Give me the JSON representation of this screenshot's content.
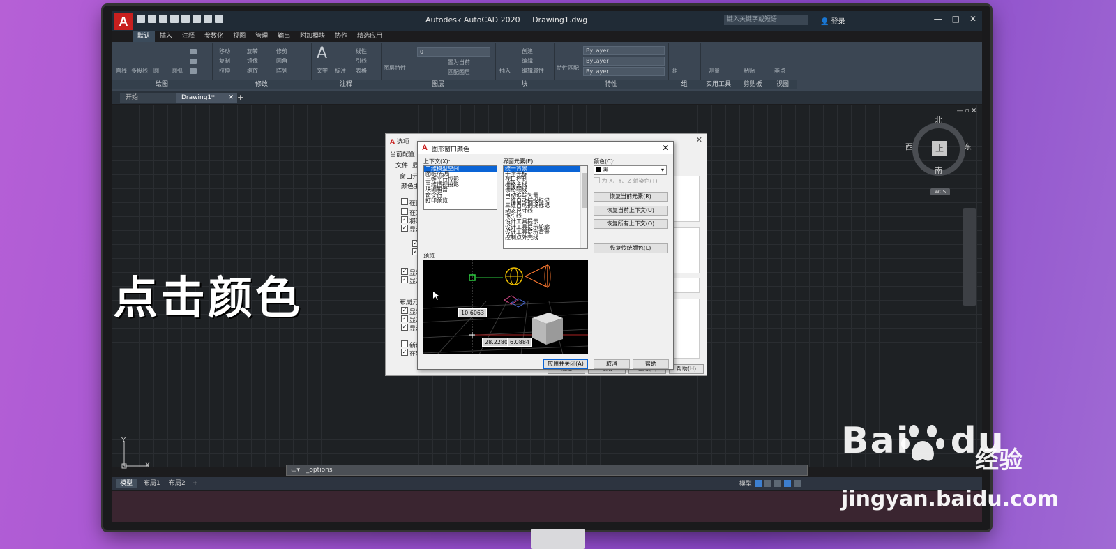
{
  "app": {
    "logo_letter": "A",
    "title": "Autodesk AutoCAD 2020",
    "filename": "Drawing1.dwg",
    "search_placeholder": "键入关键字或短语",
    "login": "登录",
    "window_controls": [
      "—",
      "□",
      "✕"
    ]
  },
  "menu_tabs": [
    "默认",
    "插入",
    "注释",
    "参数化",
    "视图",
    "管理",
    "输出",
    "附加模块",
    "协作",
    "精选应用"
  ],
  "ribbon": {
    "panels": [
      "绘图",
      "修改",
      "注释",
      "图层",
      "块",
      "特性",
      "组",
      "实用工具",
      "剪贴板",
      "视图"
    ],
    "draw_tools": [
      "直线",
      "多段线",
      "圆",
      "圆弧"
    ],
    "modify_tools": [
      "移动",
      "旋转",
      "修剪",
      "复制",
      "镜像",
      "圆角",
      "拉伸",
      "缩放",
      "阵列"
    ],
    "annotation_tools": [
      "文字",
      "标注",
      "线性",
      "引线",
      "表格"
    ],
    "layer_tools": [
      "图层特性",
      "置为当前",
      "匹配图层"
    ],
    "block_tools": [
      "插入",
      "创建",
      "编辑",
      "编辑属性"
    ],
    "property_values": [
      "ByLayer",
      "ByLayer",
      "ByLayer"
    ],
    "property_tools": [
      "特性匹配"
    ],
    "layer_value": "0",
    "other_tools": [
      "组",
      "测量",
      "粘贴",
      "基点"
    ]
  },
  "doc_tabs": [
    "开始",
    "Drawing1*"
  ],
  "canvas": {
    "overlay_text": "点击颜色",
    "compass": {
      "n": "北",
      "s": "南",
      "e": "东",
      "w": "西",
      "top": "上"
    },
    "wcs": "WCS",
    "ucs_y": "Y",
    "ucs_x": "X"
  },
  "command_line": {
    "value": "_options"
  },
  "layout_tabs": [
    "模型",
    "布局1",
    "布局2"
  ],
  "status": {
    "model": "模型"
  },
  "options_dialog": {
    "title": "选项",
    "current_profile": "当前配置:",
    "tabs": [
      "文件",
      "显"
    ],
    "window_elements": "窗口元素",
    "color_scheme": "颜色主",
    "check_labels": [
      "在图",
      "在工",
      "将功",
      "显示",
      "显示",
      "显示",
      "显示",
      "显示"
    ],
    "layout_elements": "布局元素",
    "layout_checks": [
      "显示",
      "显示",
      "显示",
      "新建",
      "在新"
    ],
    "buttons": [
      "确定",
      "取消",
      "应用(A)",
      "帮助(H)"
    ]
  },
  "color_dialog": {
    "title": "图形窗口颜色",
    "context_label": "上下文(X):",
    "contexts": [
      "二维模型空间",
      "图纸/布局",
      "三维平行投影",
      "三维透视投影",
      "块编辑器",
      "命令行",
      "打印预览"
    ],
    "elements_label": "界面元素(E):",
    "elements": [
      "统一背景",
      "十字光标",
      "视口控制",
      "栅格主线",
      "栅格辅线",
      "自动追踪矢量",
      "二维自动捕捉标记",
      "三维自动捕捉标记",
      "动态尺寸线",
      "拖引线",
      "设计工具提示",
      "设计工具提示轮廓",
      "设计工具提示背景",
      "控制点外壳线"
    ],
    "color_label": "颜色(C):",
    "color_value": "黑",
    "tint_label": "为 X、Y、Z 轴染色(T)",
    "restore_buttons": [
      "恢复当前元素(R)",
      "恢复当前上下文(U)",
      "恢复所有上下文(O)",
      "恢复传统颜色(L)"
    ],
    "preview_label": "预览",
    "preview_dims": [
      "10.6063",
      "28.2280",
      "6.0884"
    ],
    "buttons": [
      "应用并关闭(A)",
      "取消",
      "帮助"
    ]
  },
  "watermark": {
    "brand": "Bai",
    "brand2": "du",
    "jingyan": "经验",
    "url": "jingyan.baidu.com"
  },
  "colors": {
    "accent_blue": "#0a64d6",
    "autocad_red": "#c8201f",
    "ribbon_bg": "#3b4653"
  }
}
